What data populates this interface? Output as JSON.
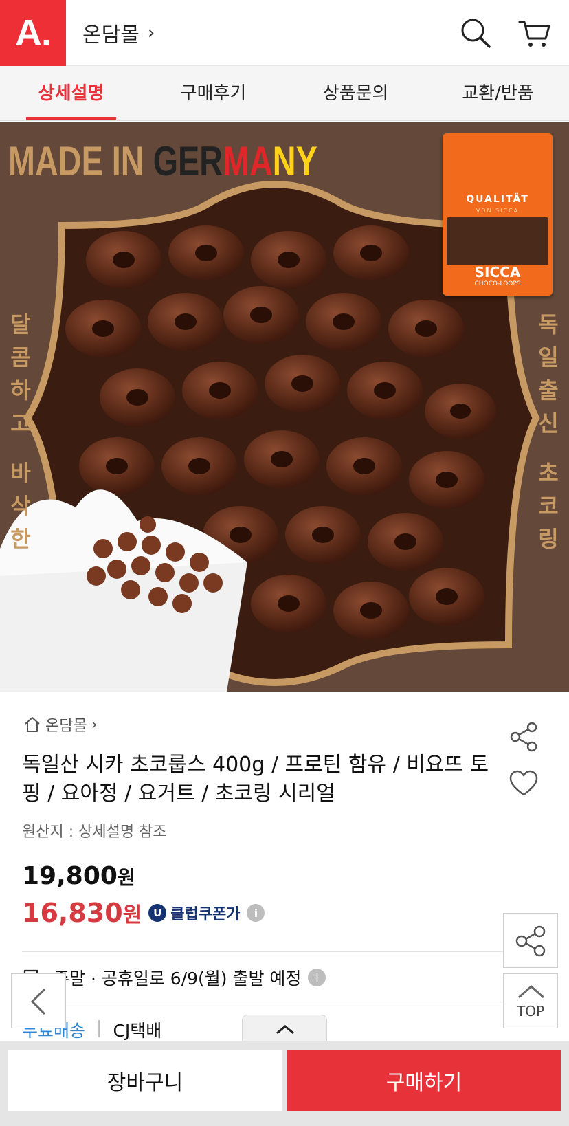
{
  "header": {
    "logo": "A.",
    "store_name": "온담몰",
    "chevron": "›",
    "icons": [
      "search-icon",
      "cart-icon"
    ]
  },
  "tabs": [
    {
      "label": "상세설명",
      "active": true
    },
    {
      "label": "구매후기",
      "active": false
    },
    {
      "label": "상품문의",
      "active": false
    },
    {
      "label": "교환/반품",
      "active": false
    }
  ],
  "hero": {
    "made_in": "MADE IN ",
    "ger": "GER",
    "ma": "MA",
    "ny": "NY",
    "left_vertical": [
      "달",
      "콤",
      "하",
      "고",
      "",
      "바",
      "삭",
      "한"
    ],
    "right_vertical": [
      "독",
      "일",
      "출",
      "신",
      "",
      "초",
      "코",
      "링"
    ],
    "package_qual": "QUALITÄT",
    "package_von": "VON SICCA",
    "package_brand": "SICCA",
    "package_sub": "CHOCO-LOOPS"
  },
  "product": {
    "breadcrumb": "온담몰",
    "breadcrumb_chevron": "›",
    "title": "독일산 시카 초코룹스 400g / 프로틴 함유 / 비요뜨 토핑 / 요아정 / 요거트 / 초코링 시리얼",
    "origin": "원산지 : 상세설명 참조",
    "price_original": "19,800",
    "price_sale": "16,830",
    "won": "원",
    "coupon_badge": "U",
    "coupon_label": "클럽쿠폰가",
    "info_glyph": "i"
  },
  "shipping": {
    "schedule": "주말 · 공휴일로 6/9(월) 출발 예정",
    "free": "무료배송",
    "separator": "|",
    "carrier": "CJ택배"
  },
  "floating": {
    "top_label": "TOP"
  },
  "actions": {
    "cart": "장바구니",
    "buy": "구매하기"
  },
  "colors": {
    "brand_red": "#ef2f36",
    "sale_red": "#d43a3f",
    "coupon_navy": "#153273",
    "free_blue": "#2f87d8",
    "hero_bg": "#64493a",
    "gold": "#c89a63"
  }
}
